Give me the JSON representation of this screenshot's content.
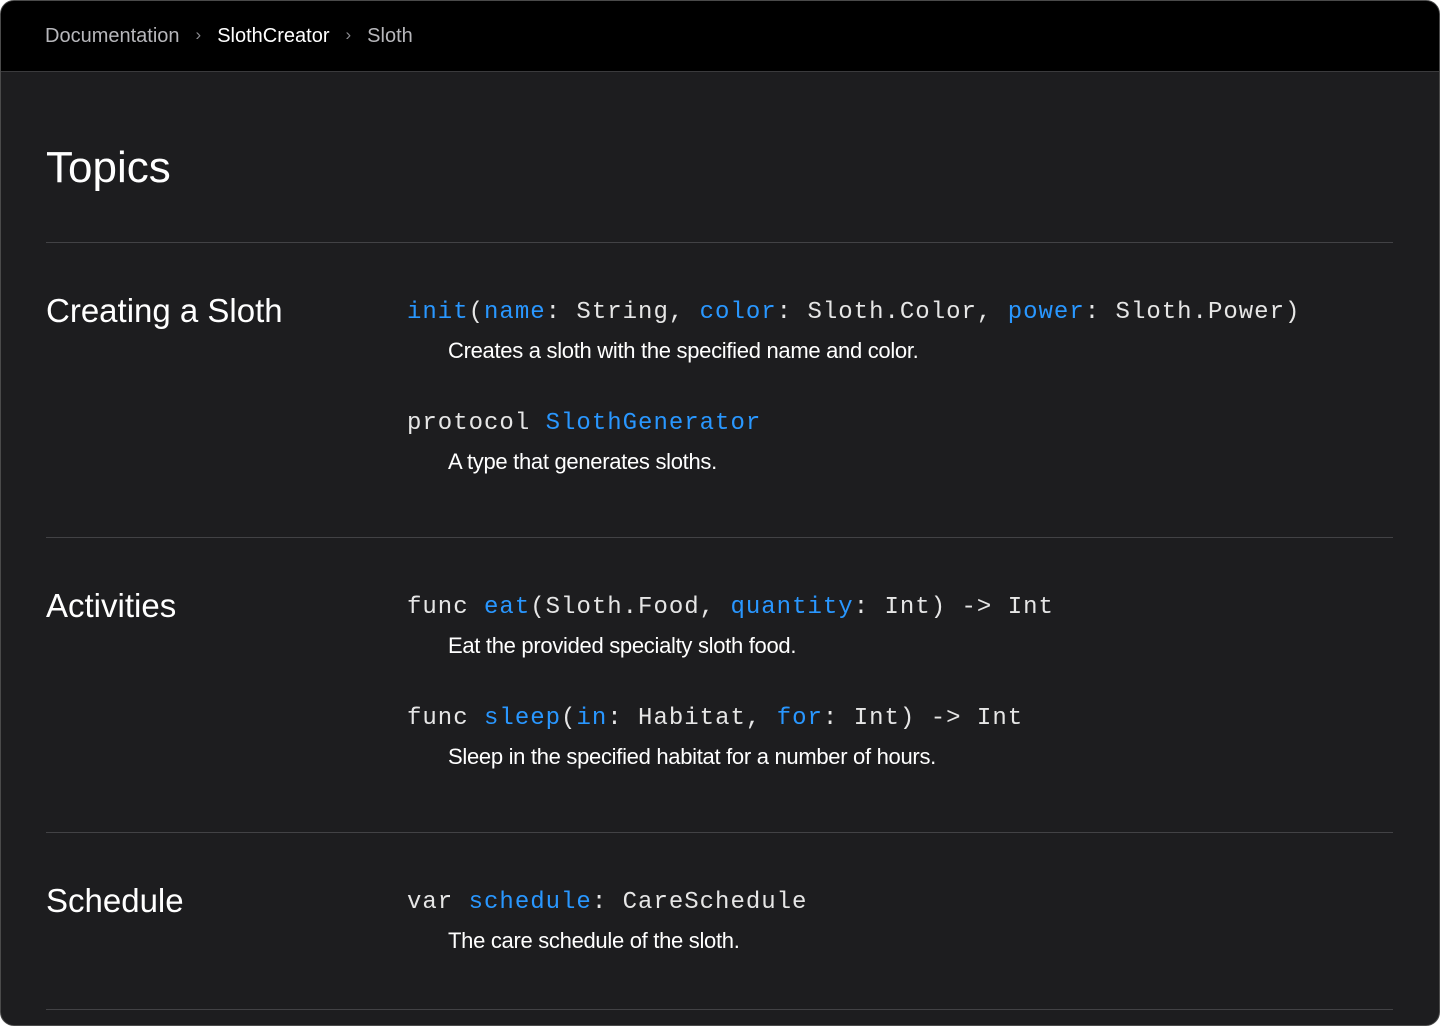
{
  "breadcrumb": [
    {
      "label": "Documentation"
    },
    {
      "label": "SlothCreator"
    },
    {
      "label": "Sloth"
    }
  ],
  "page_title": "Topics",
  "sections": [
    {
      "title": "Creating a Sloth",
      "items": [
        {
          "sig": {
            "p1": "init",
            "p2": "(",
            "p3": "name",
            "p4": ": String, ",
            "p5": "color",
            "p6": ": Sloth.Color, ",
            "p7": "power",
            "p8": ": Sloth.Power)"
          },
          "abstract": "Creates a sloth with the specified name and color."
        },
        {
          "sig": {
            "p1": "protocol ",
            "p2": "SlothGenerator"
          },
          "abstract": "A type that generates sloths."
        }
      ]
    },
    {
      "title": "Activities",
      "items": [
        {
          "sig": {
            "p1": "func ",
            "p2": "eat",
            "p3": "(Sloth.Food, ",
            "p4": "quantity",
            "p5": ": Int) -> Int"
          },
          "abstract": "Eat the provided specialty sloth food."
        },
        {
          "sig": {
            "p1": "func ",
            "p2": "sleep",
            "p3": "(",
            "p4": "in",
            "p5": ": Habitat, ",
            "p6": "for",
            "p7": ": Int) -> Int"
          },
          "abstract": "Sleep in the specified habitat for a number of hours."
        }
      ]
    },
    {
      "title": "Schedule",
      "items": [
        {
          "sig": {
            "p1": "var ",
            "p2": "schedule",
            "p3": ": CareSchedule"
          },
          "abstract": "The care schedule of the sloth."
        }
      ]
    }
  ],
  "colors": {
    "background": "#1d1d1f",
    "navbar": "#000000",
    "link": "#2997ff",
    "divider": "#424245",
    "text": "#ffffff"
  },
  "icons": [
    "chevron-right-icon"
  ]
}
